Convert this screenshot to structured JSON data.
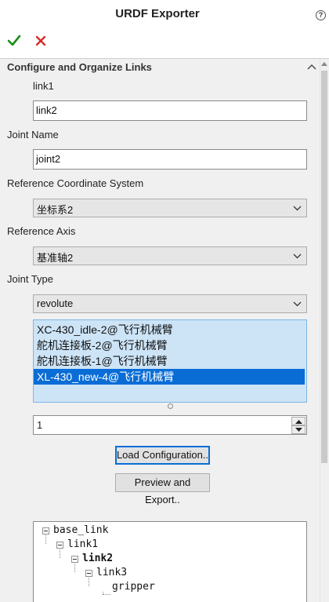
{
  "window": {
    "title": "URDF Exporter"
  },
  "toolbar": {
    "ok_icon": "checkmark-icon",
    "cancel_icon": "close-icon",
    "ok_color": "#1a8f1a",
    "cancel_color": "#d42b2b"
  },
  "section": {
    "title": "Configure and Organize Links"
  },
  "link": {
    "label": "link1",
    "value": "link2"
  },
  "joint_name": {
    "label": "Joint Name",
    "value": "joint2"
  },
  "ref_coord": {
    "label": "Reference Coordinate System",
    "value": "坐标系2"
  },
  "ref_axis": {
    "label": "Reference Axis",
    "value": "基准轴2"
  },
  "joint_type": {
    "label": "Joint Type",
    "value": "revolute"
  },
  "components": {
    "items": [
      "XC-430_idle-2@飞行机械臂",
      "舵机连接板-2@飞行机械臂",
      "舵机连接板-1@飞行机械臂",
      "XL-430_new-4@飞行机械臂"
    ],
    "selected_index": 3
  },
  "count": {
    "value": "1"
  },
  "buttons": {
    "load": "Load Configuration..",
    "preview": "Preview and Export.."
  },
  "tree": {
    "root": "base_link",
    "level1": "link1",
    "level2": "link2",
    "level3": "link3",
    "level4": "gripper"
  },
  "colors": {
    "accent": "#0a6dd6",
    "list_bg": "#cde4f7"
  }
}
